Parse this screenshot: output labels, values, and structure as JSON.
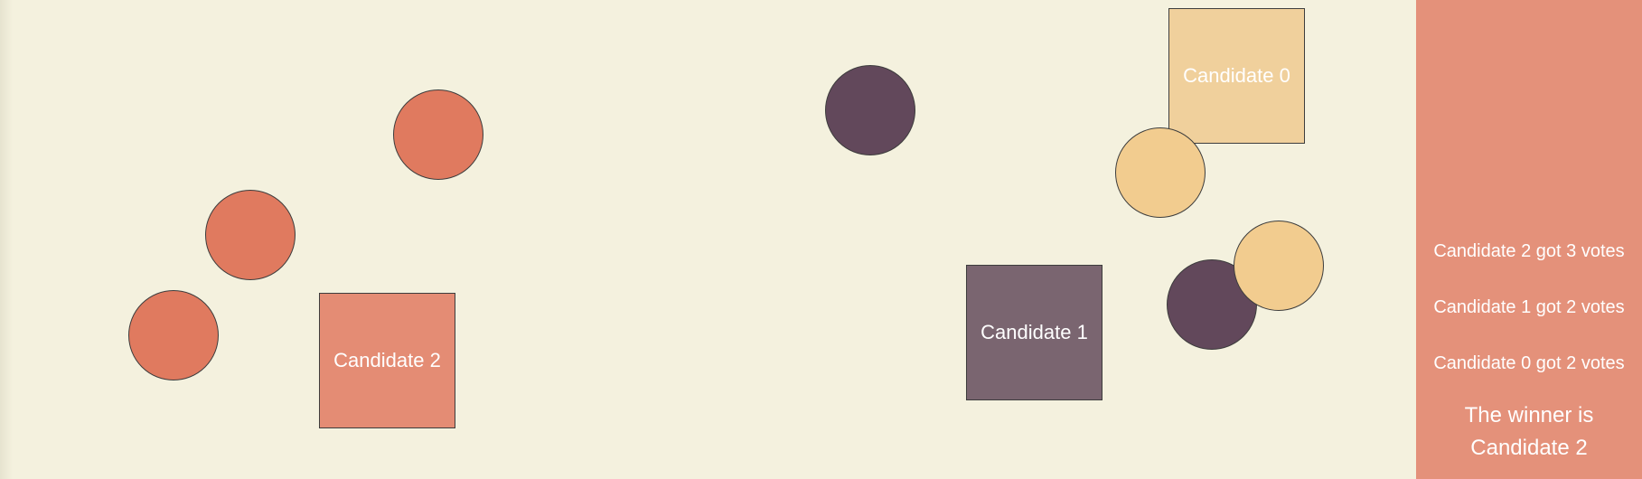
{
  "colors": {
    "background": "#f4f1de",
    "panel": "#e4917a",
    "candidate_0": "#f2cc8f",
    "candidate_1": "#5f4457",
    "candidate_2": "#e07a5f"
  },
  "candidates": [
    {
      "label": "Candidate 0",
      "color": "#f0d09c"
    },
    {
      "label": "Candidate 1",
      "color": "#7a6570"
    },
    {
      "label": "Candidate 2",
      "color": "#e48c74"
    }
  ],
  "voters": [
    {
      "vote": "Candidate 2",
      "color": "#e07a5f"
    },
    {
      "vote": "Candidate 2",
      "color": "#e07a5f"
    },
    {
      "vote": "Candidate 2",
      "color": "#e07a5f"
    },
    {
      "vote": "Candidate 1",
      "color": "#62485b"
    },
    {
      "vote": "Candidate 1",
      "color": "#62485b"
    },
    {
      "vote": "Candidate 0",
      "color": "#f2cc8f"
    },
    {
      "vote": "Candidate 0",
      "color": "#f2cc8f"
    }
  ],
  "results": {
    "lines": [
      "Candidate 2 got 3 votes",
      "Candidate 1 got 2 votes",
      "Candidate 0 got 2 votes"
    ],
    "winner_line1": "The winner is",
    "winner_line2": "Candidate 2"
  }
}
